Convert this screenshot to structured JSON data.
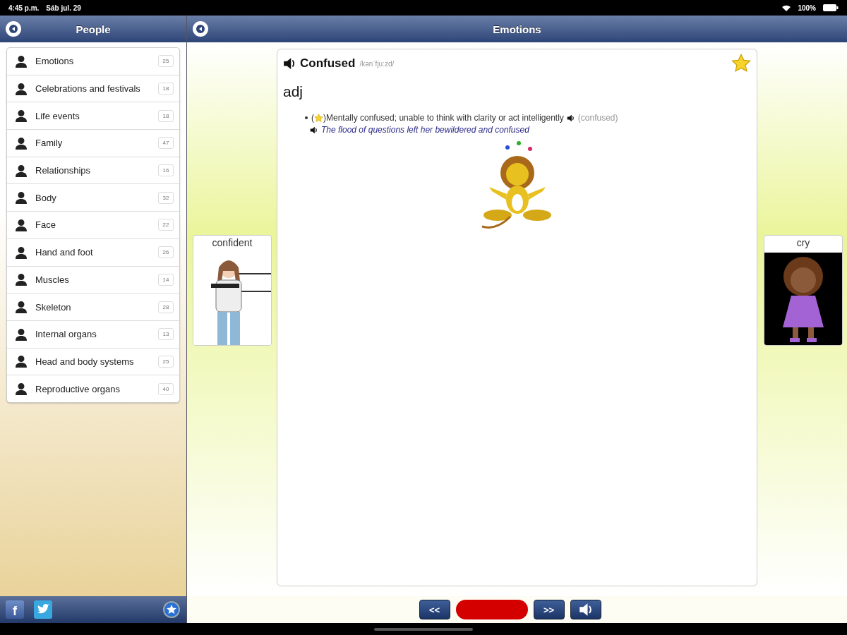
{
  "status_bar": {
    "time": "4:45 p.m.",
    "date": "Sáb jul. 29",
    "battery": "100%"
  },
  "sidebar": {
    "title": "People",
    "items": [
      {
        "label": "Emotions",
        "count": "25"
      },
      {
        "label": "Celebrations and festivals",
        "count": "18"
      },
      {
        "label": "Life events",
        "count": "18"
      },
      {
        "label": "Family",
        "count": "47"
      },
      {
        "label": "Relationships",
        "count": "16"
      },
      {
        "label": "Body",
        "count": "32"
      },
      {
        "label": "Face",
        "count": "22"
      },
      {
        "label": "Hand and foot",
        "count": "26"
      },
      {
        "label": "Muscles",
        "count": "14"
      },
      {
        "label": "Skeleton",
        "count": "28"
      },
      {
        "label": "Internal organs",
        "count": "13"
      },
      {
        "label": "Head and body systems",
        "count": "25"
      },
      {
        "label": "Reproductive organs",
        "count": "40"
      }
    ],
    "facebook_label": "f"
  },
  "main": {
    "title": "Emotions",
    "entry": {
      "word": "Confused",
      "pronunciation": "/kənˈfjuːzd/",
      "favorite": true,
      "part_of_speech": "adj",
      "sense": {
        "open": "(",
        "close": ")",
        "definition": "Mentally confused; unable to think with clarity or act intelligently",
        "synonym": "(confused)",
        "example": "The flood of questions left her bewildered and confused"
      }
    },
    "prev_card": {
      "label": "confident"
    },
    "next_card": {
      "label": "cry"
    },
    "controls": {
      "prev": "<<",
      "next": ">>"
    }
  }
}
